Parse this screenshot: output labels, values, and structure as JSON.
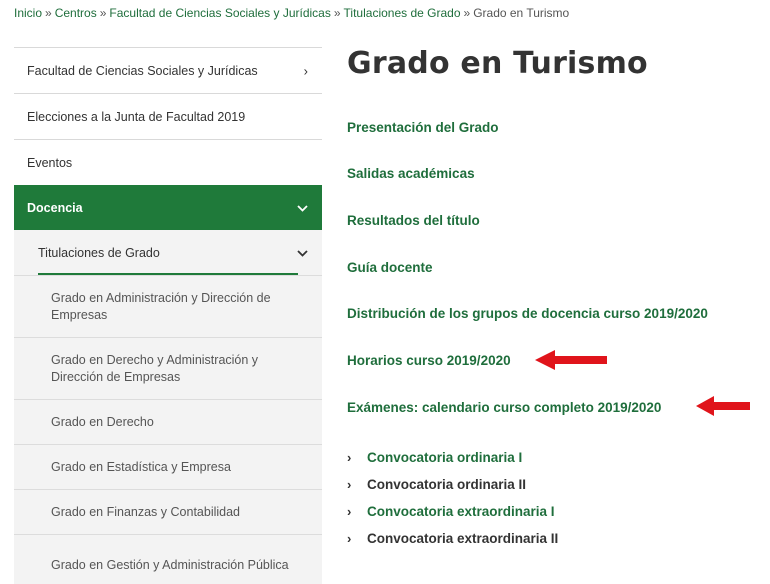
{
  "breadcrumb": {
    "items": [
      "Inicio",
      "Centros",
      "Facultad de Ciencias Sociales y Jurídicas",
      "Titulaciones de Grado"
    ],
    "current": "Grado en Turismo",
    "separator": "»"
  },
  "sidebar": {
    "items": [
      {
        "label": "Facultad de Ciencias Sociales y Jurídicas",
        "chevron": "›"
      },
      {
        "label": "Elecciones a la Junta de Facultad 2019"
      },
      {
        "label": "Eventos"
      }
    ],
    "active": {
      "label": "Docencia",
      "chevron": "⌄"
    },
    "sub": {
      "label": "Titulaciones de Grado",
      "chevron": "⌄"
    },
    "leaves": [
      "Grado en Administración y Dirección de Empresas",
      "Grado en Derecho y Administración y Dirección de Empresas",
      "Grado en Derecho",
      "Grado en Estadística y Empresa",
      "Grado en Finanzas y Contabilidad",
      "Grado en Gestión y Administración Pública"
    ]
  },
  "main": {
    "title": "Grado en Turismo",
    "links": [
      "Presentación del Grado",
      "Salidas académicas",
      "Resultados del título",
      "Guía docente",
      "Distribución de los grupos de docencia curso 2019/2020",
      "Horarios curso 2019/2020",
      "Exámenes: calendario curso completo 2019/2020"
    ],
    "sub_links": [
      {
        "label": "Convocatoria ordinaria I",
        "style": "green"
      },
      {
        "label": "Convocatoria ordinaria II",
        "style": "dark"
      },
      {
        "label": "Convocatoria extraordinaria I",
        "style": "green"
      },
      {
        "label": "Convocatoria extraordinaria II",
        "style": "dark"
      }
    ]
  },
  "colors": {
    "brand_green": "#1f7a3a",
    "link_green": "#1f6e3c",
    "arrow_red": "#e0141b"
  },
  "icons": {
    "caret": "›"
  }
}
